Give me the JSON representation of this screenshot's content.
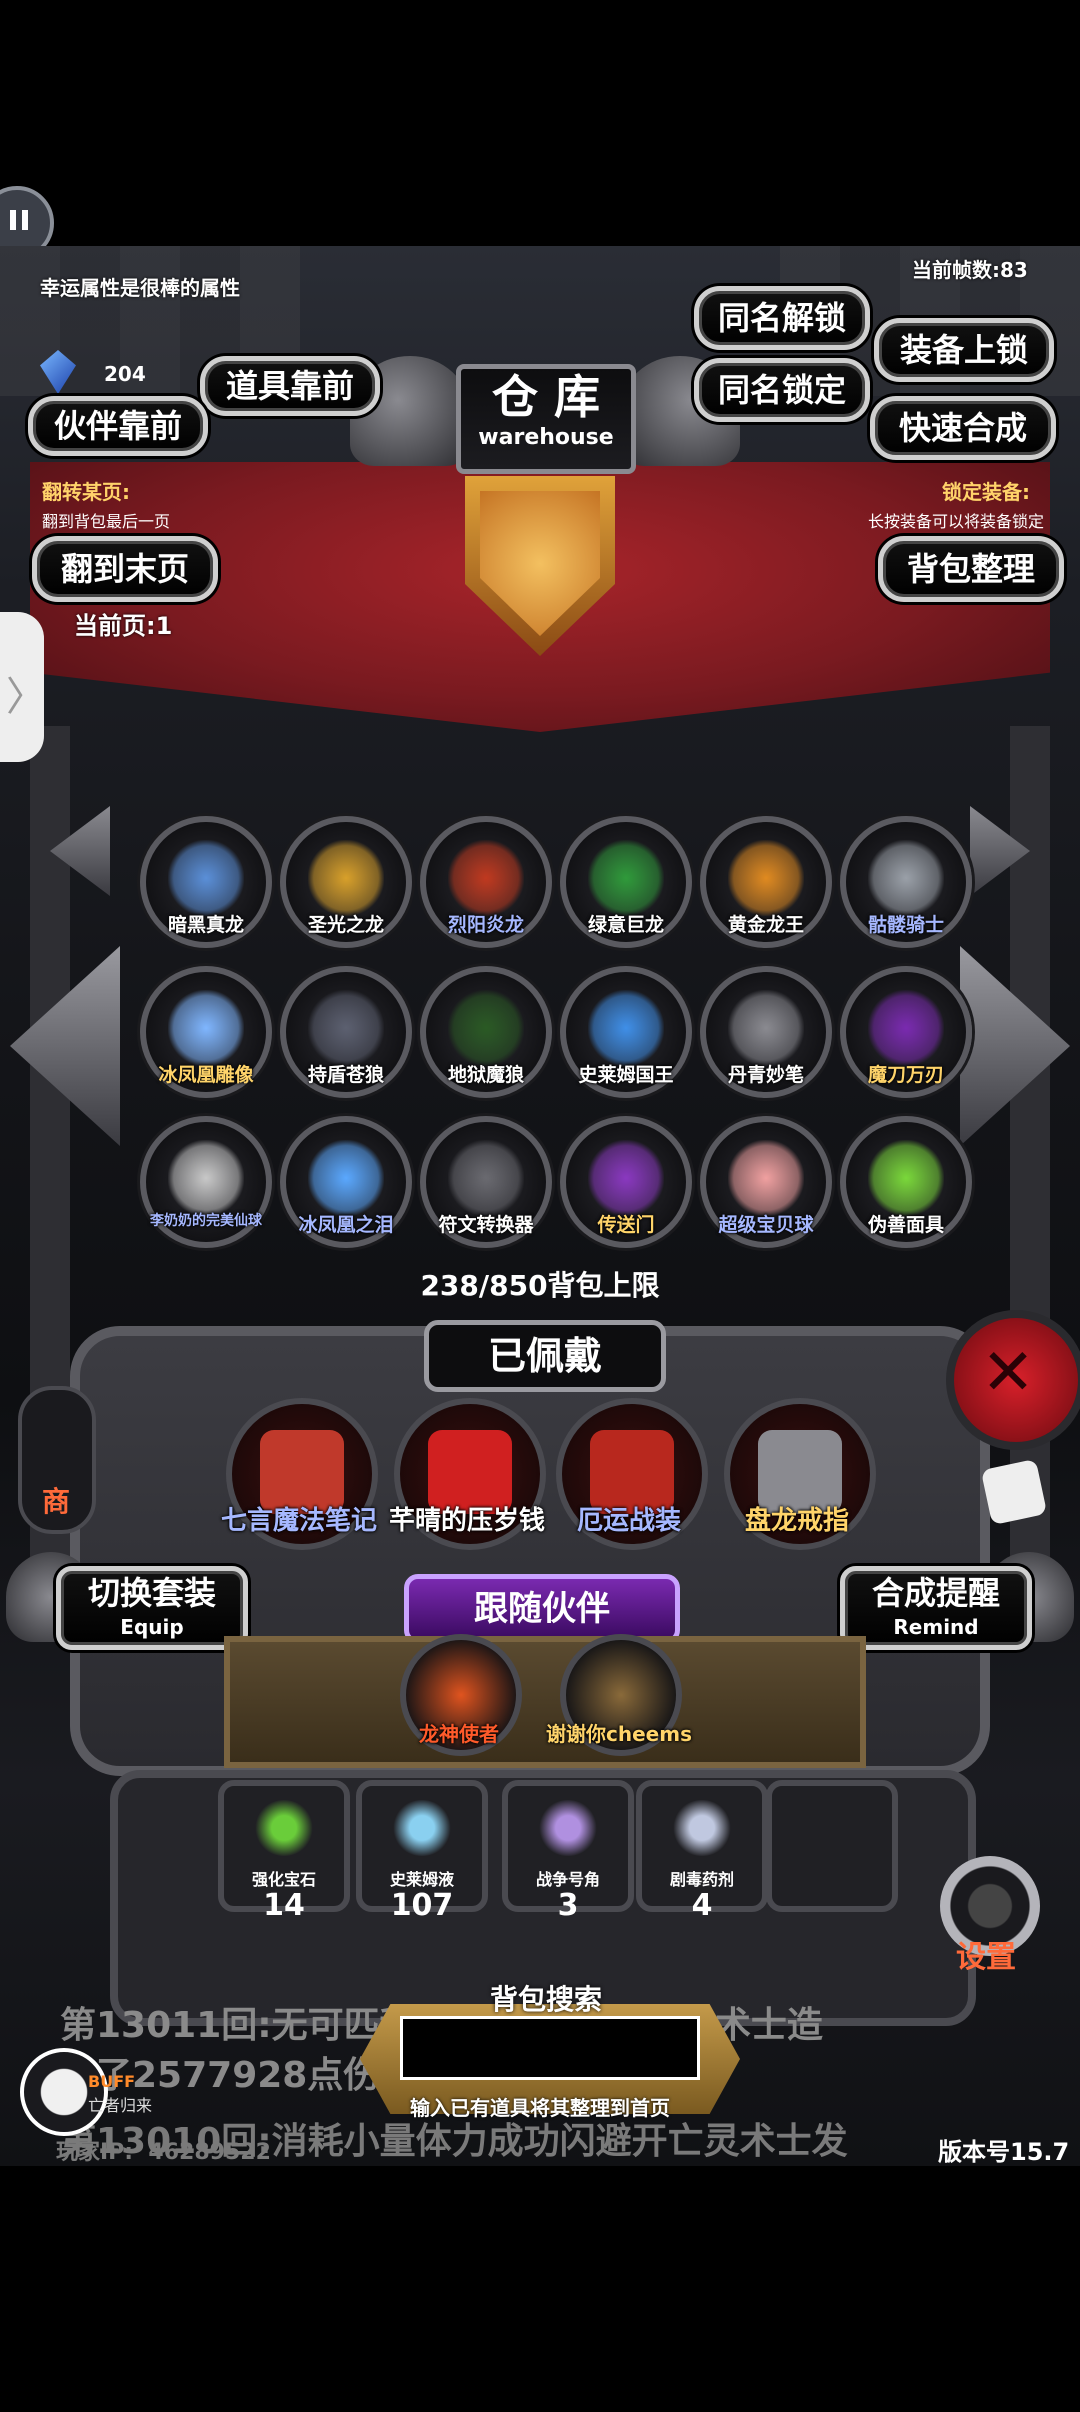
{
  "top_left_msg": "幸运属性是很棒的属性",
  "fps": "当前帧数:83",
  "gem_count": "204",
  "warehouse": {
    "title_cn": "仓 库",
    "title_en": "warehouse"
  },
  "buttons": {
    "same_name_unlock": "同名解锁",
    "equip_lock": "装备上锁",
    "items_front": "道具靠前",
    "same_name_lock": "同名锁定",
    "partner_front": "伙伴靠前",
    "quick_synth": "快速合成",
    "to_last_page": "翻到末页",
    "bag_sort": "背包整理"
  },
  "flip_hint_title": "翻转某页:",
  "flip_hint_sub": "翻到背包最后一页",
  "lock_hint_title": "锁定装备:",
  "lock_hint_sub": "长按装备可以将装备锁定",
  "current_page": "当前页:1",
  "items": [
    {
      "name": "暗黑真龙",
      "color": "#ffffff",
      "art": "#5a8fd8"
    },
    {
      "name": "圣光之龙",
      "color": "#ffffff",
      "art": "#d8a02a"
    },
    {
      "name": "烈阳炎龙",
      "color": "#a6b8ff",
      "art": "#c0391f"
    },
    {
      "name": "绿意巨龙",
      "color": "#ffffff",
      "art": "#2f9a3a"
    },
    {
      "name": "黄金龙王",
      "color": "#ffffff",
      "art": "#e08a20"
    },
    {
      "name": "骷髅骑士",
      "color": "#a6b8ff",
      "art": "#9aa0a8"
    },
    {
      "name": "冰凤凰雕像",
      "color": "#ffd46a",
      "art": "#7fb6ff"
    },
    {
      "name": "持盾苍狼",
      "color": "#ffffff",
      "art": "#5c6070"
    },
    {
      "name": "地狱魔狼",
      "color": "#ffffff",
      "art": "#2a5a24"
    },
    {
      "name": "史莱姆国王",
      "color": "#ffffff",
      "art": "#3f8fe8"
    },
    {
      "name": "丹青妙笔",
      "color": "#ffffff",
      "art": "#8a8a90"
    },
    {
      "name": "魔刀万刃",
      "color": "#ffd46a",
      "art": "#7a2ab0"
    },
    {
      "name": "李奶奶的完美仙球",
      "color": "#a6b8ff",
      "art": "#c8c8c8"
    },
    {
      "name": "冰凤凰之泪",
      "color": "#a6b8ff",
      "art": "#5aa8ff"
    },
    {
      "name": "符文转换器",
      "color": "#ffffff",
      "art": "#6a6a70"
    },
    {
      "name": "传送门",
      "color": "#ffd46a",
      "art": "#8a38c0"
    },
    {
      "name": "超级宝贝球",
      "color": "#a6b8ff",
      "art": "#f0a0a0"
    },
    {
      "name": "伪善面具",
      "color": "#ffffff",
      "art": "#7ad83a"
    }
  ],
  "capacity": "238/850背包上限",
  "equipped_title": "已佩戴",
  "equipped": [
    {
      "name": "七言魔法笔记",
      "color": "#a6b8ff",
      "art": "#c0392b"
    },
    {
      "name": "芊晴的压岁钱",
      "color": "#ffffff",
      "art": "#d02020"
    },
    {
      "name": "厄运战装",
      "color": "#a6b8ff",
      "art": "#b8281e"
    },
    {
      "name": "盘龙戒指",
      "color": "#ffd46a",
      "art": "#8a8a90"
    }
  ],
  "switch_set": {
    "cn": "切换套装",
    "en": "Equip"
  },
  "synth_remind": {
    "cn": "合成提醒",
    "en": "Remind"
  },
  "follow_partner": "跟随伙伴",
  "partners": [
    {
      "name": "龙神使者",
      "color": "#ff5a2a",
      "art": "#e0541f"
    },
    {
      "name": "谢谢你cheems",
      "color": "#ffd46a",
      "art": "#8a6a3a"
    }
  ],
  "consumables": [
    {
      "name": "强化宝石",
      "count": "14",
      "art": "#6acd3a"
    },
    {
      "name": "史莱姆液",
      "count": "107",
      "art": "#8ad0f0"
    },
    {
      "name": "战争号角",
      "count": "3",
      "art": "#b090e0"
    },
    {
      "name": "剧毒药剂",
      "count": "4",
      "art": "#c0c8e0"
    }
  ],
  "battle_log_1": "第13011回:无可匹敌                     灵术士造",
  "battle_log_2": "成了2577928点伤",
  "battle_log_3": "第13010回:消耗小量体力成功闪避开亡灵术士发",
  "search": {
    "title": "背包搜索",
    "placeholder": "",
    "hint": "输入已有道具将其整理到首页"
  },
  "buff_label": "BUFF",
  "buff_sub": "亡者归来",
  "settings": "设置",
  "shop": "商",
  "player_ip": "玩家IP:  46289522",
  "version": "版本号15.7"
}
